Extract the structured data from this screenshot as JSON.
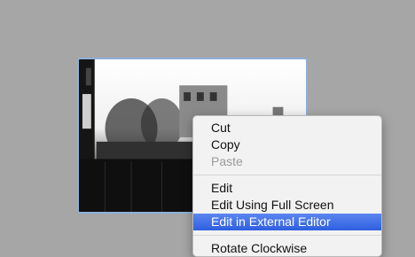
{
  "context_menu": {
    "items": [
      {
        "label": "Cut",
        "enabled": true
      },
      {
        "label": "Copy",
        "enabled": true
      },
      {
        "label": "Paste",
        "enabled": false
      },
      {
        "label": "Edit",
        "enabled": true
      },
      {
        "label": "Edit Using Full Screen",
        "enabled": true
      },
      {
        "label": "Edit in External Editor",
        "enabled": true,
        "highlighted": true
      },
      {
        "label": "Rotate Clockwise",
        "enabled": true
      }
    ]
  },
  "colors": {
    "desktop": "#a6a6a6",
    "selection_border": "#8fb0d8",
    "menu_highlight": "#3a6ae6"
  }
}
